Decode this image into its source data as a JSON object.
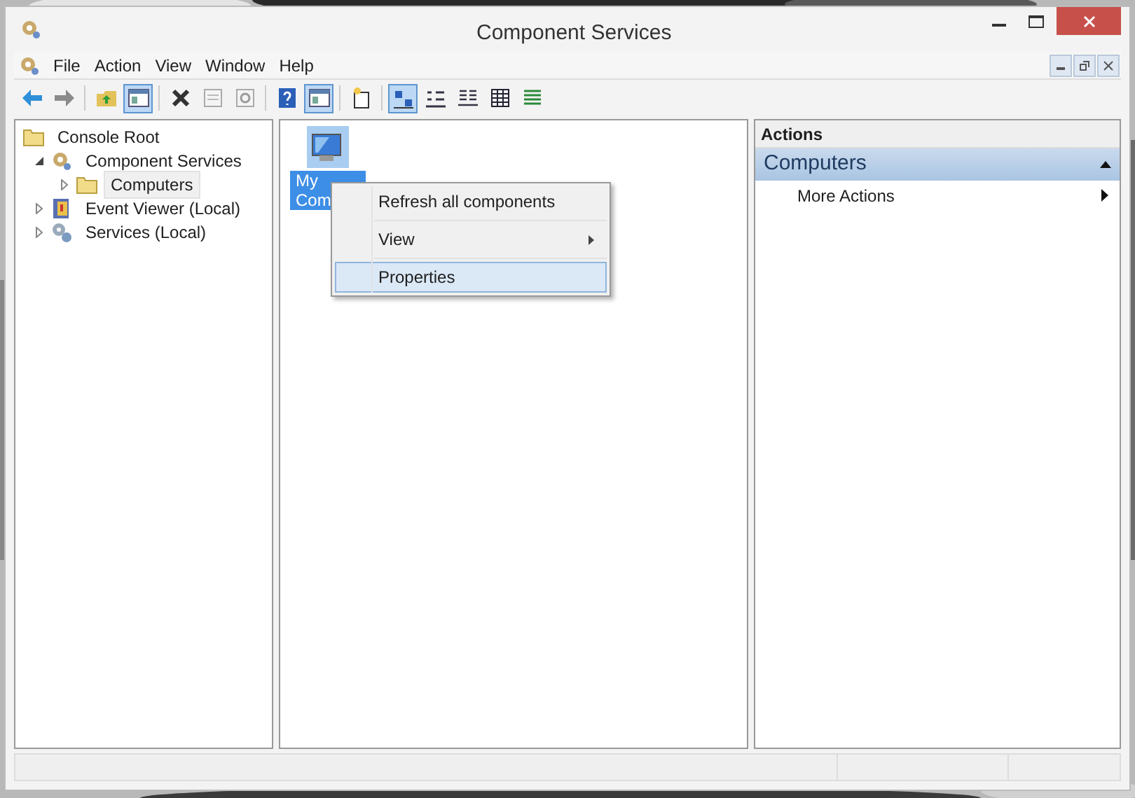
{
  "window": {
    "title": "Component Services"
  },
  "menu": [
    "File",
    "Action",
    "View",
    "Window",
    "Help"
  ],
  "toolbar": [
    {
      "kind": "back",
      "pressed": false
    },
    {
      "kind": "forward",
      "pressed": false
    },
    {
      "kind": "sep"
    },
    {
      "kind": "up",
      "pressed": false
    },
    {
      "kind": "tree",
      "pressed": true
    },
    {
      "kind": "sep"
    },
    {
      "kind": "delete",
      "pressed": false
    },
    {
      "kind": "props",
      "pressed": false
    },
    {
      "kind": "refresh",
      "pressed": false
    },
    {
      "kind": "sep"
    },
    {
      "kind": "help",
      "pressed": false
    },
    {
      "kind": "tree",
      "pressed": true
    },
    {
      "kind": "sep"
    },
    {
      "kind": "new",
      "pressed": false
    },
    {
      "kind": "sep"
    },
    {
      "kind": "largeicons",
      "pressed": true
    },
    {
      "kind": "smallicons",
      "pressed": false
    },
    {
      "kind": "list",
      "pressed": false
    },
    {
      "kind": "details",
      "pressed": false
    },
    {
      "kind": "status",
      "pressed": false
    }
  ],
  "tree": [
    {
      "label": "Console Root",
      "kind": "folder",
      "selected": false,
      "children": [
        {
          "label": "Component Services",
          "kind": "gear",
          "selected": false,
          "expanded": true,
          "children": [
            {
              "label": "Computers",
              "kind": "folder",
              "selected": true,
              "expanded": false
            }
          ]
        },
        {
          "label": "Event Viewer (Local)",
          "kind": "book",
          "selected": false,
          "expanded": false
        },
        {
          "label": "Services (Local)",
          "kind": "gears",
          "selected": false,
          "expanded": false
        }
      ]
    }
  ],
  "items": [
    {
      "lines": [
        "My",
        "Com"
      ],
      "selected": true
    }
  ],
  "context_menu": [
    {
      "label": "Refresh all components",
      "selected": false,
      "submenu": false
    },
    {
      "label": "View",
      "selected": false,
      "submenu": true
    },
    {
      "label": "Properties",
      "selected": true,
      "submenu": false
    }
  ],
  "actions": {
    "header": "Actions",
    "sections": [
      {
        "title": "Computers",
        "expanded": true,
        "items": [
          {
            "label": "More Actions",
            "submenu": true
          }
        ]
      }
    ]
  }
}
